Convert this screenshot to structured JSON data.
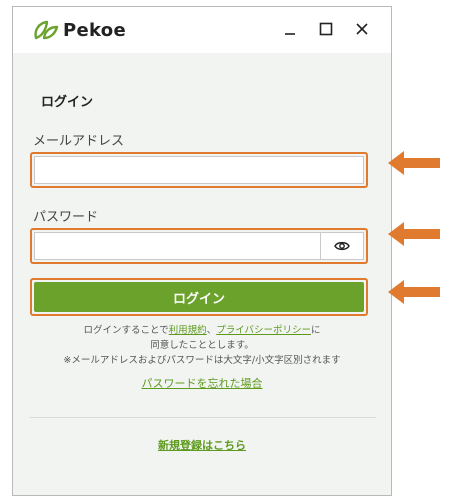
{
  "app": {
    "name": "Pekoe"
  },
  "window_controls": {
    "minimize": "_",
    "maximize": "□",
    "close": "×"
  },
  "form": {
    "heading": "ログイン",
    "email_label": "メールアドレス",
    "email_value": "",
    "password_label": "パスワード",
    "password_value": "",
    "password_toggle_icon": "eye-icon",
    "submit_label": "ログイン"
  },
  "terms": {
    "line1_prefix": "ログインすることで",
    "terms_link": "利用規約",
    "separator": "、",
    "privacy_link": "プライバシーポリシー",
    "line1_suffix": "に",
    "line2": "同意したこととします。",
    "note": "※メールアドレスおよびパスワードは大文字/小文字区別されます"
  },
  "links": {
    "forgot_password": "パスワードを忘れた場合",
    "register": "新規登録はこちら"
  },
  "colors": {
    "accent_green": "#6aa22c",
    "link_green": "#5d9a1e",
    "highlight_orange": "#e07a2e",
    "body_bg": "#f2f4f2"
  }
}
